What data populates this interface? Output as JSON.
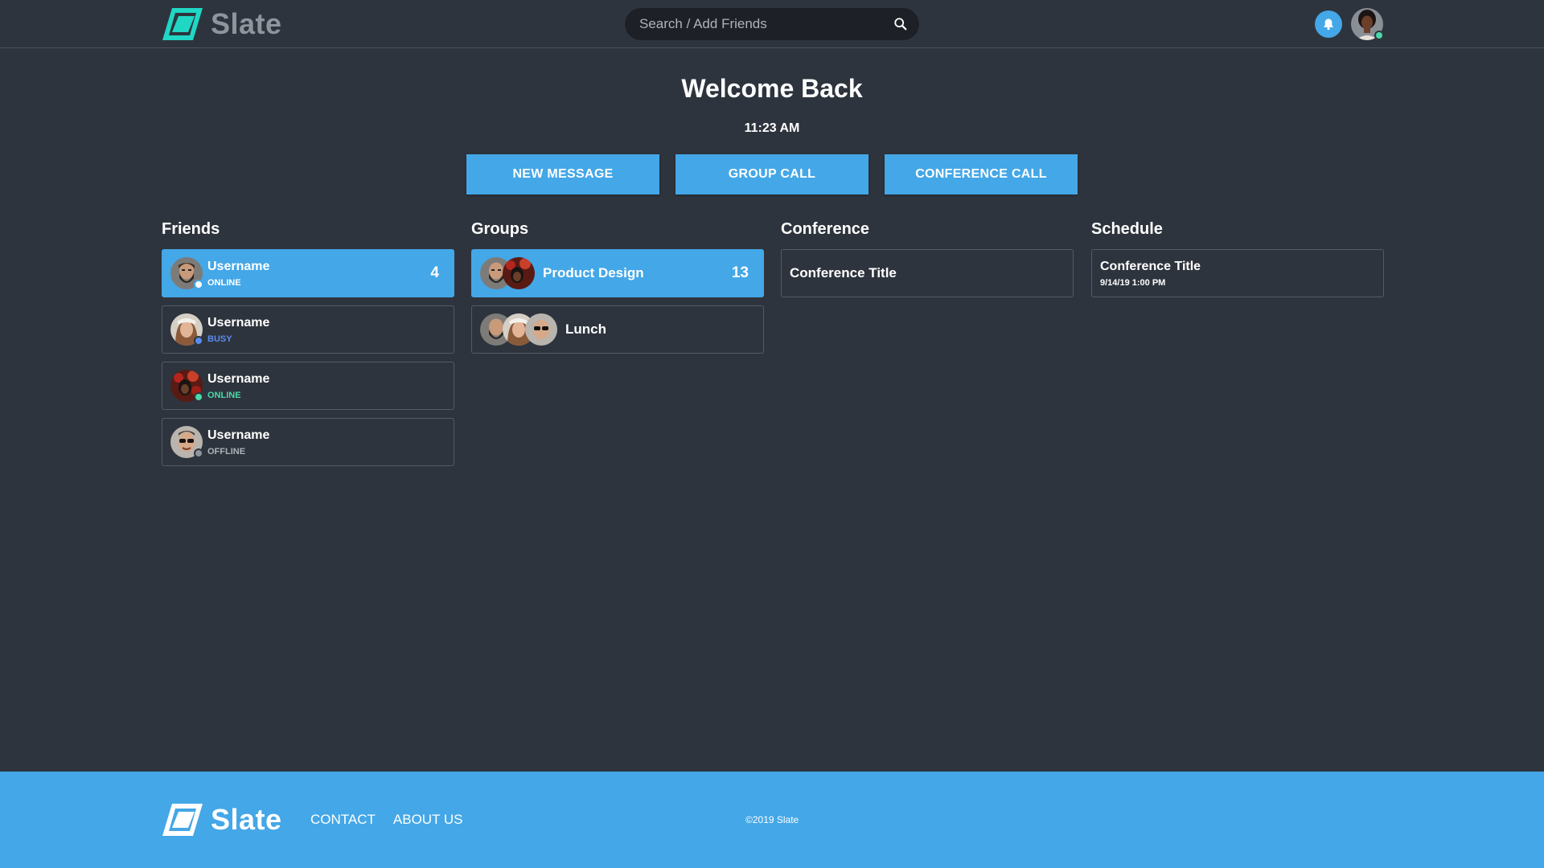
{
  "app": {
    "name": "Slate",
    "colors": {
      "accent": "#44a7e7",
      "background": "#2e343d",
      "logo_cyan": "#1fd7c4",
      "online": "#4bd8a8",
      "busy": "#5b8cf0",
      "offline": "#8f959d"
    }
  },
  "header": {
    "logo_text": "Slate",
    "search": {
      "placeholder": "Search / Add Friends",
      "icon": "search-icon"
    },
    "notification_icon": "bell-icon"
  },
  "welcome": {
    "title": "Welcome Back",
    "time": "11:23 AM"
  },
  "actions": {
    "new_message": "NEW MESSAGE",
    "group_call": "GROUP CALL",
    "conference_call": "CONFERENCE CALL"
  },
  "friends": {
    "title": "Friends",
    "items": [
      {
        "name": "Username",
        "status": "ONLINE",
        "badge": "4"
      },
      {
        "name": "Username",
        "status": "BUSY"
      },
      {
        "name": "Username",
        "status": "ONLINE"
      },
      {
        "name": "Username",
        "status": "OFFLINE"
      }
    ]
  },
  "groups": {
    "title": "Groups",
    "items": [
      {
        "name": "Product Design",
        "badge": "13"
      },
      {
        "name": "Lunch"
      }
    ]
  },
  "conference": {
    "title": "Conference",
    "items": [
      {
        "title": "Conference Title"
      }
    ]
  },
  "schedule": {
    "title": "Schedule",
    "items": [
      {
        "title": "Conference Title",
        "date": "9/14/19 1:00 PM"
      }
    ]
  },
  "footer": {
    "logo_text": "Slate",
    "contact": "CONTACT",
    "about": "ABOUT US",
    "copyright": "©2019 Slate"
  }
}
